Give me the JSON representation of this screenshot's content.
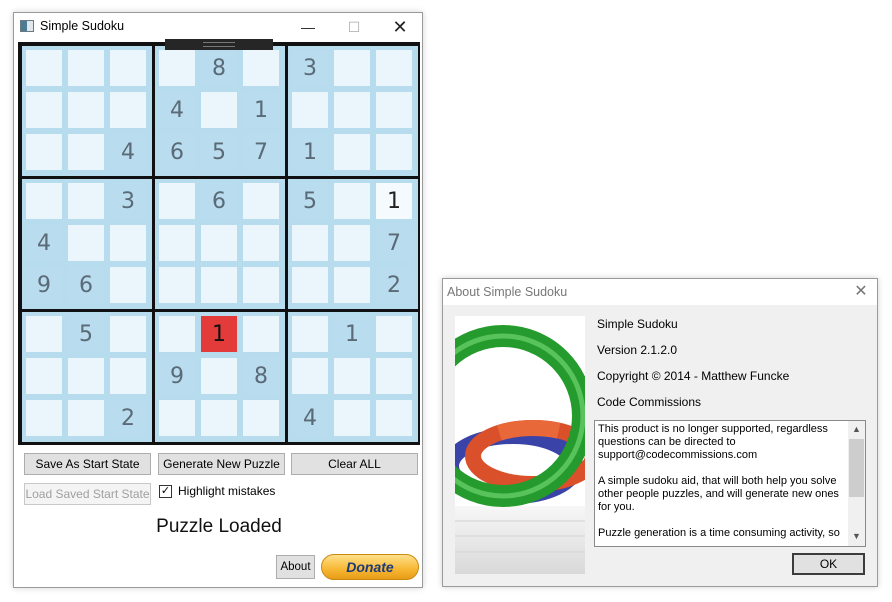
{
  "window": {
    "title": "Simple Sudoku",
    "controls": {
      "minimize": "—",
      "maximize": "☐",
      "close": "✕"
    }
  },
  "sudoku": {
    "grid": [
      [
        "",
        "",
        "",
        "",
        "8",
        "",
        "3",
        "",
        ""
      ],
      [
        "",
        "",
        "",
        "4",
        "",
        "1",
        "",
        "",
        ""
      ],
      [
        "",
        "",
        "4",
        "6",
        "5",
        "7",
        "1",
        "",
        ""
      ],
      [
        "",
        "",
        "3",
        "",
        "6",
        "",
        "5",
        "",
        "1"
      ],
      [
        "4",
        "",
        "",
        "",
        "",
        "",
        "",
        "",
        "7"
      ],
      [
        "9",
        "6",
        "",
        "",
        "",
        "",
        "",
        "",
        "2"
      ],
      [
        "",
        "5",
        "",
        "",
        "1",
        "",
        "",
        "1",
        ""
      ],
      [
        "",
        "",
        "",
        "9",
        "",
        "8",
        "",
        "",
        ""
      ],
      [
        "",
        "",
        "2",
        "",
        "",
        "",
        "4",
        "",
        ""
      ]
    ],
    "user_entries": [
      [
        3,
        8
      ]
    ],
    "error_cells": [
      [
        6,
        4
      ]
    ],
    "colors": {
      "box_border": "#111111",
      "box_fill": "#b7dcee",
      "empty_cell": "#eaf5fc",
      "given_cell": "#b9dcef",
      "error": "#e33a3a"
    }
  },
  "buttons": {
    "save_start_state": "Save As Start State",
    "generate_puzzle": "Generate New Puzzle",
    "clear_all": "Clear ALL",
    "load_saved_start_state": "Load Saved Start State",
    "about": "About",
    "donate": "Donate"
  },
  "options": {
    "highlight_mistakes_label": "Highlight mistakes",
    "highlight_mistakes_checked": "✓"
  },
  "status_text": "Puzzle Loaded",
  "about_dialog": {
    "title": "About Simple Sudoku",
    "close": "✕",
    "product_name": "Simple Sudoku",
    "version": "Version 2.1.2.0",
    "copyright": "Copyright ©  2014 - Matthew Funcke",
    "company": "Code Commissions",
    "description": "This product is no longer supported, regardless questions can be directed to support@codecommissions.com\n\nA simple sudoku aid, that will both help you solve other people puzzles, and will generate new ones for you.\n\nPuzzle generation is a time consuming activity, so",
    "ok": "OK"
  }
}
